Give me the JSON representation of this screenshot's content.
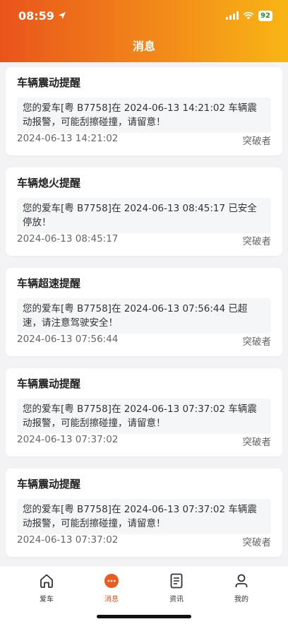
{
  "status_bar": {
    "time": "08:59",
    "battery": "92"
  },
  "nav": {
    "title": "消息"
  },
  "messages": [
    {
      "title": "车辆震动提醒",
      "body": "您的爱车[粤 B7758]在 2024-06-13 14:21:02 车辆震动报警，可能刮擦碰撞，请留意！",
      "time": "2024-06-13 14:21:02",
      "sender": "突破者"
    },
    {
      "title": "车辆熄火提醒",
      "body": "您的爱车[粤 B7758]在 2024-06-13 08:45:17 已安全停放！",
      "time": "2024-06-13 08:45:17",
      "sender": "突破者"
    },
    {
      "title": "车辆超速提醒",
      "body": "您的爱车[粤 B7758]在 2024-06-13 07:56:44 已超速，请注意驾驶安全！",
      "time": "2024-06-13 07:56:44",
      "sender": "突破者"
    },
    {
      "title": "车辆震动提醒",
      "body": "您的爱车[粤 B7758]在 2024-06-13 07:37:02 车辆震动报警，可能刮擦碰撞，请留意！",
      "time": "2024-06-13 07:37:02",
      "sender": "突破者"
    },
    {
      "title": "车辆震动提醒",
      "body": "您的爱车[粤 B7758]在 2024-06-13 07:37:02 车辆震动报警，可能刮擦碰撞，请留意！",
      "time": "2024-06-13 07:37:02",
      "sender": "突破者"
    }
  ],
  "tabbar": {
    "tabs": [
      {
        "label": "爱车",
        "icon": "home-icon"
      },
      {
        "label": "消息",
        "icon": "message-icon"
      },
      {
        "label": "资讯",
        "icon": "news-icon"
      },
      {
        "label": "我的",
        "icon": "profile-icon"
      }
    ]
  },
  "colors": {
    "accent": "#e9541b",
    "gradient_end": "#f8b514"
  }
}
